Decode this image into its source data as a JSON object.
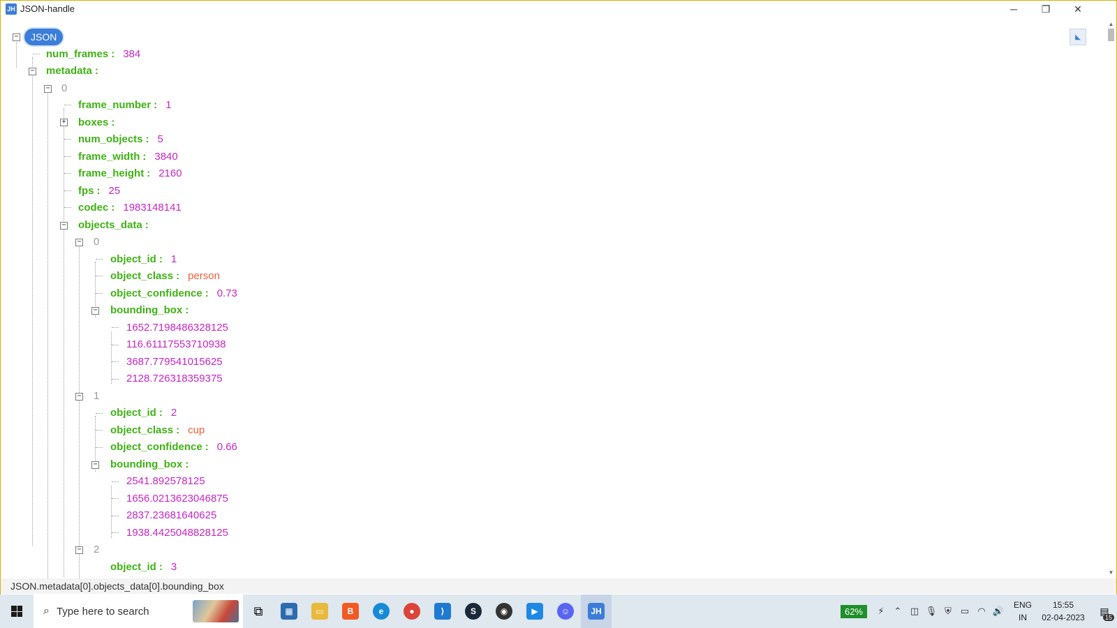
{
  "window": {
    "icon_text": "JH",
    "title": "JSON-handle",
    "minimize": "─",
    "restore": "❐",
    "close": "✕"
  },
  "tree": {
    "root_label": "JSON",
    "num_frames_key": "num_frames",
    "num_frames_value": "384",
    "metadata_key": "metadata",
    "metadata_index": "0",
    "frame_number_key": "frame_number",
    "frame_number_value": "1",
    "boxes_key": "boxes",
    "num_objects_key": "num_objects",
    "num_objects_value": "5",
    "frame_width_key": "frame_width",
    "frame_width_value": "3840",
    "frame_height_key": "frame_height",
    "frame_height_value": "2160",
    "fps_key": "fps",
    "fps_value": "25",
    "codec_key": "codec",
    "codec_value": "1983148141",
    "objects_data_key": "objects_data",
    "objects": [
      {
        "index": "0",
        "object_id": "1",
        "object_class": "person",
        "object_confidence": "0.73",
        "bounding_box": [
          "1652.7198486328125",
          "116.61117553710938",
          "3687.779541015625",
          "2128.726318359375"
        ]
      },
      {
        "index": "1",
        "object_id": "2",
        "object_class": "cup",
        "object_confidence": "0.66",
        "bounding_box": [
          "2541.892578125",
          "1656.0213623046875",
          "2837.23681640625",
          "1938.4425048828125"
        ]
      },
      {
        "index": "2",
        "object_id": "3"
      }
    ],
    "labels": {
      "object_id": "object_id",
      "object_class": "object_class",
      "object_confidence": "object_confidence",
      "bounding_box": "bounding_box",
      "colon": ":"
    }
  },
  "statusbar": {
    "path": "JSON.metadata[0].objects_data[0].bounding_box"
  },
  "taskbar": {
    "search_placeholder": "Type here to search",
    "battery": "62%",
    "lang_top": "ENG",
    "lang_bottom": "IN",
    "time": "15:55",
    "date": "02-04-2023",
    "notification_count": "15",
    "apps": [
      "task-view",
      "microsoft-store",
      "file-explorer",
      "brave",
      "edge",
      "chrome",
      "vscode",
      "steam",
      "obs",
      "media-player",
      "discord",
      "json-handle"
    ]
  },
  "colors": {
    "key": "#3fb214",
    "number": "#c626c6",
    "string": "#ef5d3a",
    "accent": "#3b7dd8"
  }
}
